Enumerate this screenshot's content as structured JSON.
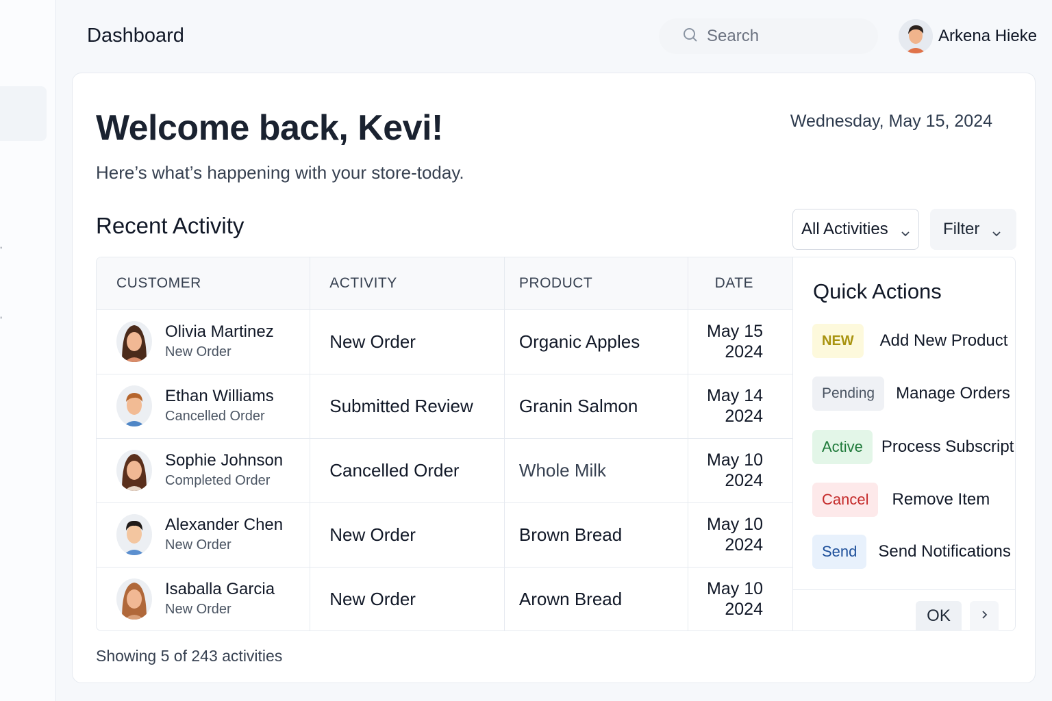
{
  "header": {
    "title": "Dashboard",
    "search_placeholder": "Search",
    "user_name": "Arkena Hieke"
  },
  "main": {
    "welcome": "Welcome back, Kevi!",
    "subtitle": "Here’s what’s happening with your store-today.",
    "date": "Wednesday, May 15, 2024",
    "section_title": "Recent Activity",
    "activity_select": "All Activities",
    "filter_label": "Filter",
    "showing": "Showing 5 of 243 activities"
  },
  "table": {
    "columns": [
      "CUSTOMER",
      "ACTIVITY",
      "PRODUCT",
      "DATE"
    ],
    "rows": [
      {
        "name": "Olivia Martinez",
        "status": "New Order",
        "activity": "New Order",
        "product": "Organic Apples",
        "date_md": "May 15",
        "date_y": "2024"
      },
      {
        "name": "Ethan Williams",
        "status": "Cancelled Order",
        "activity": "Submitted Review",
        "product": "Granin Salmon",
        "date_md": "May 14",
        "date_y": "2024"
      },
      {
        "name": "Sophie Johnson",
        "status": "Completed Order",
        "activity": "Cancelled Order",
        "product": "Whole Milk",
        "date_md": "May 10",
        "date_y": "2024"
      },
      {
        "name": "Alexander Chen",
        "status": "New Order",
        "activity": "New Order",
        "product": "Brown Bread",
        "date_md": "May 10",
        "date_y": "2024"
      },
      {
        "name": "Isaballa Garcia",
        "status": "New Order",
        "activity": "New Order",
        "product": "Arown Bread",
        "date_md": "May 10",
        "date_y": "2024"
      }
    ]
  },
  "quick_actions": {
    "title": "Quick Actions",
    "items": [
      {
        "badge": "NEW",
        "label": "Add New Product"
      },
      {
        "badge": "Pending",
        "label": "Manage Orders"
      },
      {
        "badge": "Active",
        "label": "Process Subscript"
      },
      {
        "badge": "Cancel",
        "label": "Remove Item"
      },
      {
        "badge": "Send",
        "label": "Send Notifications"
      }
    ],
    "ok_label": "OK"
  },
  "colors": {
    "badge_new_bg": "#fdf9dc",
    "badge_new_fg": "#a8930f",
    "badge_pending_bg": "#eff1f5",
    "badge_pending_fg": "#4b5563",
    "badge_active_bg": "#e3f6e8",
    "badge_active_fg": "#1f7a3a",
    "badge_cancel_bg": "#fde9ea",
    "badge_cancel_fg": "#c52b2b",
    "badge_send_bg": "#e8f1fc",
    "badge_send_fg": "#1d4f9a"
  },
  "icons": [
    "search-icon",
    "user-avatar",
    "chevron-down-icon",
    "chevron-right-icon"
  ]
}
